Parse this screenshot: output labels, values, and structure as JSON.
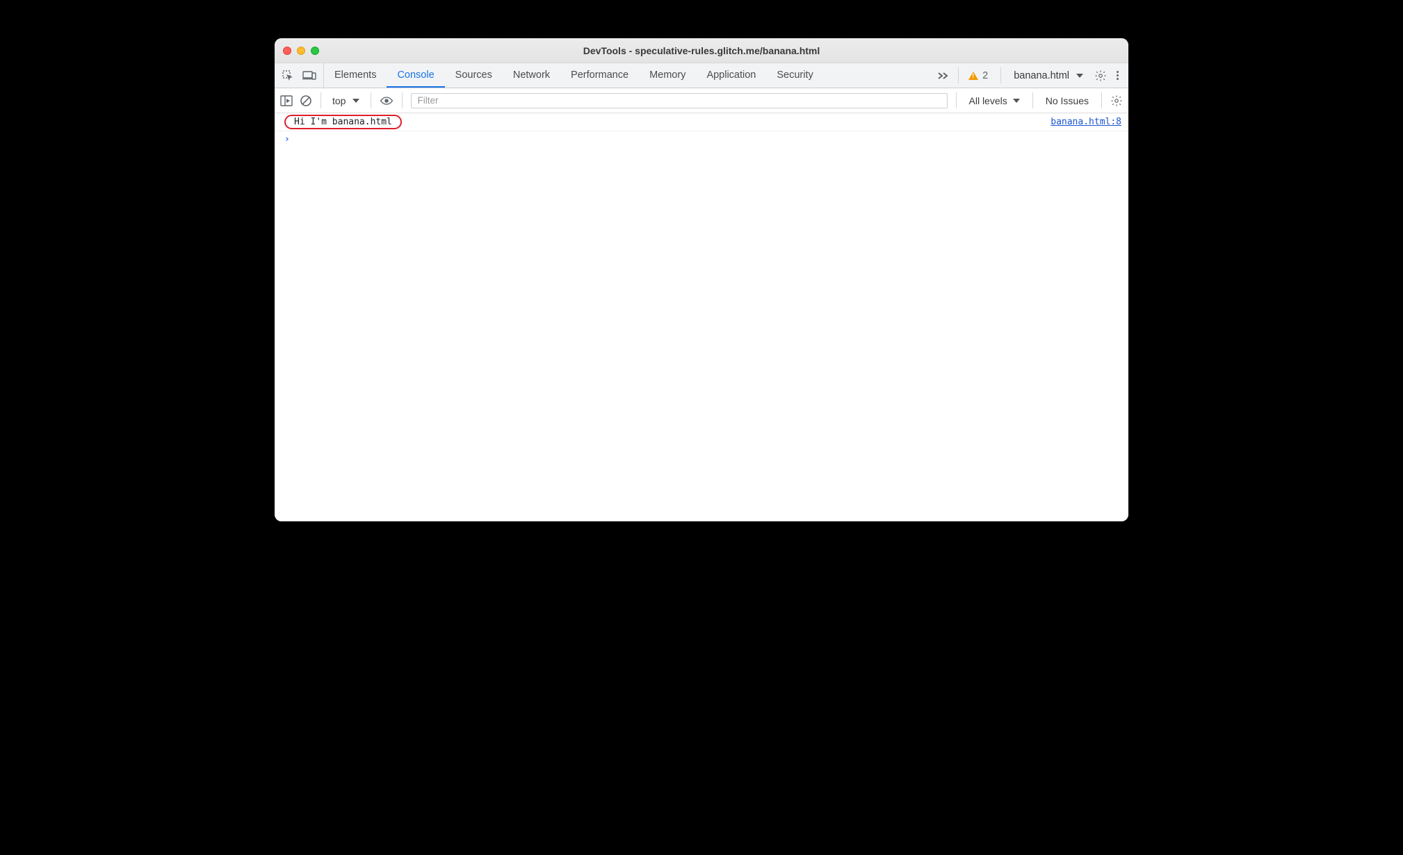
{
  "window": {
    "title": "DevTools - speculative-rules.glitch.me/banana.html"
  },
  "tabs": {
    "items": [
      {
        "label": "Elements"
      },
      {
        "label": "Console"
      },
      {
        "label": "Sources"
      },
      {
        "label": "Network"
      },
      {
        "label": "Performance"
      },
      {
        "label": "Memory"
      },
      {
        "label": "Application"
      },
      {
        "label": "Security"
      }
    ],
    "active_index": 1,
    "warning_count": "2",
    "target_selector": "banana.html"
  },
  "filter": {
    "context": "top",
    "input_value": "",
    "input_placeholder": "Filter",
    "levels_label": "All levels",
    "issues_label": "No Issues"
  },
  "console": {
    "log_message": "Hi I'm banana.html",
    "log_source": "banana.html:8",
    "prompt": "›"
  }
}
